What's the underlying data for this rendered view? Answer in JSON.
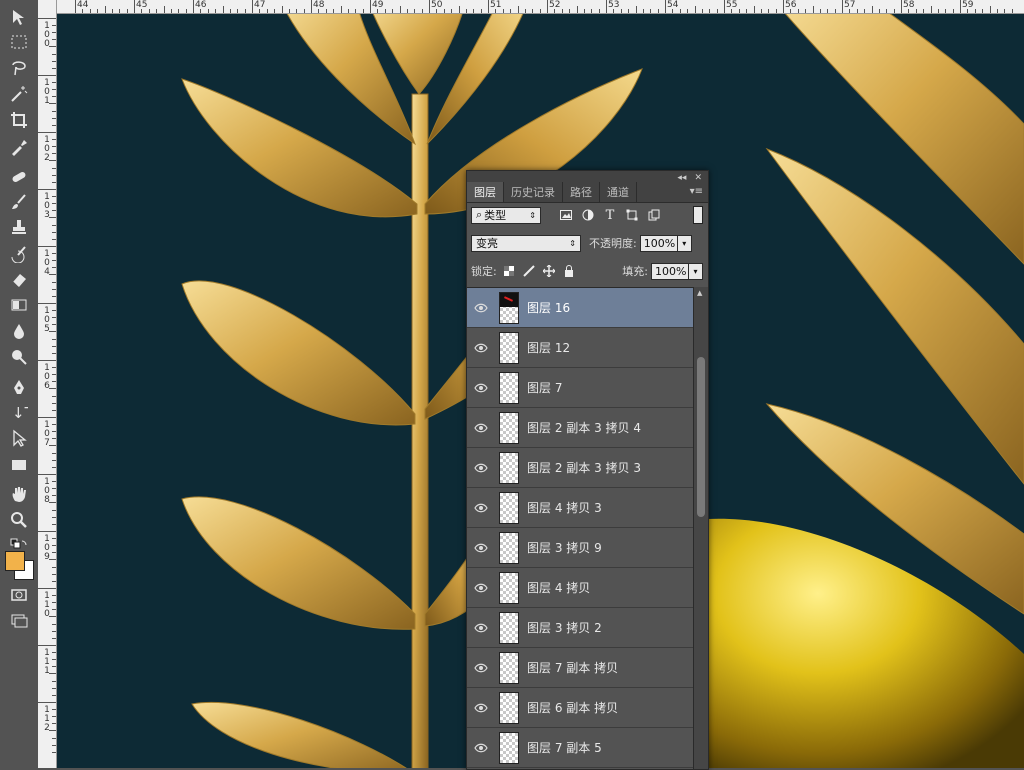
{
  "ruler": {
    "top": [
      "44",
      "45",
      "46",
      "47",
      "48",
      "49",
      "50",
      "51",
      "52",
      "53",
      "54",
      "55",
      "56",
      "57",
      "58",
      "59"
    ],
    "left": [
      "1 0 0",
      "1 0 1",
      "1 0 2",
      "1 0 3",
      "1 0 4",
      "1 0 5",
      "1 0 6",
      "1 0 7",
      "1 0 8",
      "1 0 9",
      "1 1 0",
      "1 1 1",
      "1 1 2"
    ]
  },
  "tools": [
    "move-tool",
    "marquee-tool",
    "lasso-tool",
    "magic-wand-tool",
    "crop-tool",
    "eyedropper-tool",
    "healing-brush-tool",
    "brush-tool",
    "clone-stamp-tool",
    "history-brush-tool",
    "eraser-tool",
    "gradient-tool",
    "blur-tool",
    "dodge-tool",
    "pen-tool",
    "type-tool",
    "path-selection-tool",
    "rectangle-tool",
    "hand-tool",
    "zoom-tool",
    "swap-colors",
    "quick-mask",
    "screen-mode"
  ],
  "colors": {
    "foreground": "#f2b24a",
    "background": "#ffffff",
    "canvas": "#0d2a35",
    "gold": "#d9b257",
    "selection": "#6e7f98"
  },
  "panel": {
    "tabs": [
      "图层",
      "历史记录",
      "路径",
      "通道"
    ],
    "active_tab": "图层",
    "filter_label": "类型",
    "blend_mode": "变亮",
    "opacity_label": "不透明度:",
    "opacity_value": "100%",
    "lock_label": "锁定:",
    "fill_label": "填充:",
    "fill_value": "100%",
    "layers": [
      {
        "name": "图层 16",
        "selected": true
      },
      {
        "name": "图层 12",
        "selected": false
      },
      {
        "name": "图层 7",
        "selected": false
      },
      {
        "name": "图层 2 副本 3 拷贝 4",
        "selected": false
      },
      {
        "name": "图层 2 副本 3 拷贝 3",
        "selected": false
      },
      {
        "name": "图层 4 拷贝 3",
        "selected": false
      },
      {
        "name": "图层 3 拷贝 9",
        "selected": false
      },
      {
        "name": "图层 4 拷贝",
        "selected": false
      },
      {
        "name": "图层 3 拷贝 2",
        "selected": false
      },
      {
        "name": "图层 7 副本 拷贝",
        "selected": false
      },
      {
        "name": "图层 6 副本 拷贝",
        "selected": false
      },
      {
        "name": "图层 7 副本 5",
        "selected": false
      }
    ]
  }
}
